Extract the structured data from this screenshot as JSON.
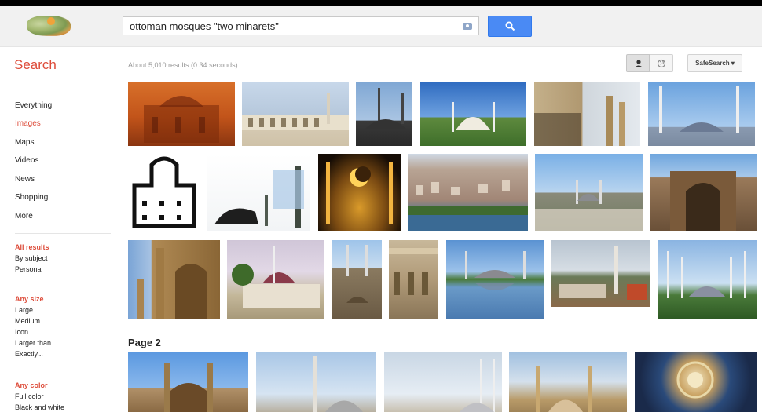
{
  "header": {
    "search_query": "ottoman mosques \"two minarets\""
  },
  "search_title": "Search",
  "result_stats": "About 5,010 results (0.34 seconds)",
  "safesearch_label": "SafeSearch ▾",
  "sidebar": {
    "nav": [
      "Everything",
      "Images",
      "Maps",
      "Videos",
      "News",
      "Shopping",
      "More"
    ],
    "active_nav": "Images",
    "filters": [
      {
        "heading": "All results",
        "items": [
          "By subject",
          "Personal"
        ]
      },
      {
        "heading": "Any size",
        "items": [
          "Large",
          "Medium",
          "Icon",
          "Larger than...",
          "Exactly..."
        ]
      },
      {
        "heading": "Any color",
        "items": [
          "Full color",
          "Black and white"
        ]
      }
    ]
  },
  "page2_label": "Page 2",
  "colors": {
    "accent": "#dd4b39",
    "button_blue": "#4a8af4",
    "header_bg": "#f1f1f1"
  }
}
